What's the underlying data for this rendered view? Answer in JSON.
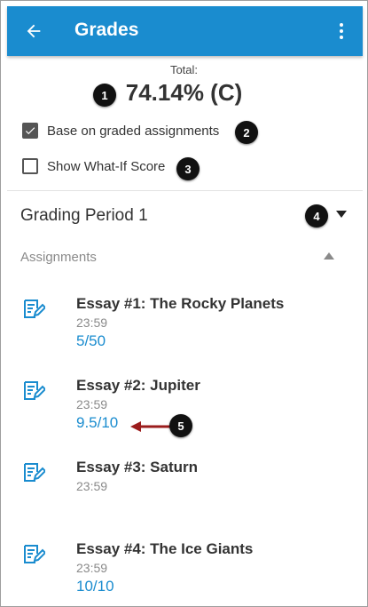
{
  "appbar": {
    "title": "Grades",
    "back_icon": "arrow-left-icon",
    "menu_icon": "more-vert-icon",
    "color": "#1a8ccf"
  },
  "summary": {
    "total_label": "Total:",
    "total_value": "74.14% (C)",
    "base_on_graded_label": "Base on graded assignments",
    "base_on_graded_checked": true,
    "what_if_label": "Show What-If Score",
    "what_if_checked": false
  },
  "grading_period": {
    "label": "Grading Period 1"
  },
  "assignments_section": {
    "title": "Assignments",
    "items": [
      {
        "name": "Essay #1: The Rocky Planets",
        "due": "23:59",
        "score": "5/50"
      },
      {
        "name": "Essay #2: Jupiter",
        "due": "23:59",
        "score": "9.5/10"
      },
      {
        "name": "Essay #3: Saturn",
        "due": "23:59",
        "score": ""
      },
      {
        "name": "Essay #4: The Ice Giants",
        "due": "23:59",
        "score": "10/10"
      }
    ]
  },
  "callouts": [
    "1",
    "2",
    "3",
    "4",
    "5"
  ],
  "colors": {
    "accent": "#1a8ccf",
    "callout": "#111111",
    "arrow": "#9b1c1c"
  }
}
